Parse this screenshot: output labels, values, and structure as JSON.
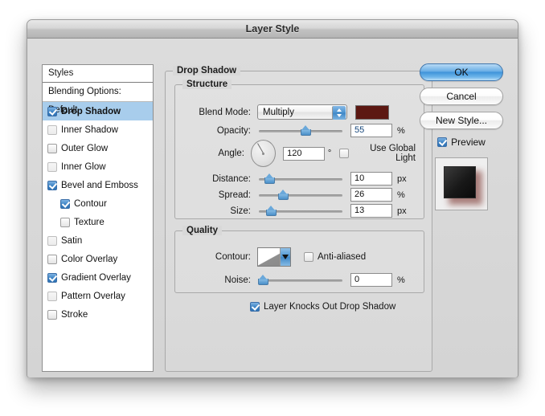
{
  "window": {
    "title": "Layer Style"
  },
  "styles_panel": {
    "header": "Styles",
    "blending_options": "Blending Options: Default",
    "items": [
      {
        "label": "Drop Shadow",
        "checked": true,
        "selected": true,
        "indent": false
      },
      {
        "label": "Inner Shadow",
        "checked": false,
        "selected": false,
        "indent": false,
        "dim": true
      },
      {
        "label": "Outer Glow",
        "checked": false,
        "selected": false,
        "indent": false
      },
      {
        "label": "Inner Glow",
        "checked": false,
        "selected": false,
        "indent": false,
        "dim": true
      },
      {
        "label": "Bevel and Emboss",
        "checked": true,
        "selected": false,
        "indent": false
      },
      {
        "label": "Contour",
        "checked": true,
        "selected": false,
        "indent": true
      },
      {
        "label": "Texture",
        "checked": false,
        "selected": false,
        "indent": true
      },
      {
        "label": "Satin",
        "checked": false,
        "selected": false,
        "indent": false,
        "dim": true
      },
      {
        "label": "Color Overlay",
        "checked": false,
        "selected": false,
        "indent": false
      },
      {
        "label": "Gradient Overlay",
        "checked": true,
        "selected": false,
        "indent": false
      },
      {
        "label": "Pattern Overlay",
        "checked": false,
        "selected": false,
        "indent": false,
        "dim": true
      },
      {
        "label": "Stroke",
        "checked": false,
        "selected": false,
        "indent": false
      }
    ]
  },
  "drop_shadow": {
    "group_label": "Drop Shadow",
    "structure": {
      "group_label": "Structure",
      "blend_mode": {
        "label": "Blend Mode:",
        "value": "Multiply",
        "color": "#5c1812"
      },
      "opacity": {
        "label": "Opacity:",
        "value": "55",
        "unit": "%",
        "slider_pct": 55
      },
      "angle": {
        "label": "Angle:",
        "value": "120",
        "unit": "°",
        "degrees": 120
      },
      "use_global_light": {
        "label": "Use Global Light",
        "checked": false
      },
      "distance": {
        "label": "Distance:",
        "value": "10",
        "unit": "px",
        "slider_pct": 10
      },
      "spread": {
        "label": "Spread:",
        "value": "26",
        "unit": "%",
        "slider_pct": 26
      },
      "size": {
        "label": "Size:",
        "value": "13",
        "unit": "px",
        "slider_pct": 13
      }
    },
    "quality": {
      "group_label": "Quality",
      "contour": {
        "label": "Contour:"
      },
      "anti_aliased": {
        "label": "Anti-aliased",
        "checked": false
      },
      "noise": {
        "label": "Noise:",
        "value": "0",
        "unit": "%",
        "slider_pct": 0
      }
    },
    "knockout": {
      "label": "Layer Knocks Out Drop Shadow",
      "checked": true
    }
  },
  "buttons": {
    "ok": "OK",
    "cancel": "Cancel",
    "new_style": "New Style...",
    "preview": {
      "label": "Preview",
      "checked": true
    }
  }
}
